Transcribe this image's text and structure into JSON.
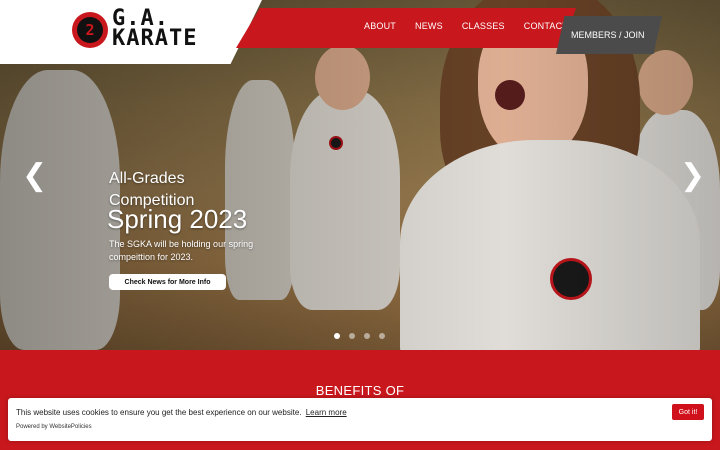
{
  "logo": {
    "mark": "2",
    "line1": "G.A.",
    "line2": "KARATE"
  },
  "nav": {
    "items": [
      "ABOUT",
      "NEWS",
      "CLASSES",
      "CONTACT"
    ],
    "members": "MEMBERS / JOIN"
  },
  "slide": {
    "title": "All-Grades Competition",
    "subtitle": "Spring 2023",
    "text": "The SGKA will be holding our spring compeittion for 2023.",
    "button": "Check News for More Info",
    "prev": "❮",
    "next": "❯",
    "slide_count": 4,
    "active_slide": 1
  },
  "benefits": {
    "title": "BENEFITS OF"
  },
  "cookie": {
    "message": "This website uses cookies to ensure you get the best experience on our website.",
    "learn_more": "Learn more",
    "powered": "Powered by WebsitePolicies",
    "button": "Got it!"
  },
  "colors": {
    "brand_red": "#c8171d",
    "members_gray": "#4b4b4b"
  }
}
